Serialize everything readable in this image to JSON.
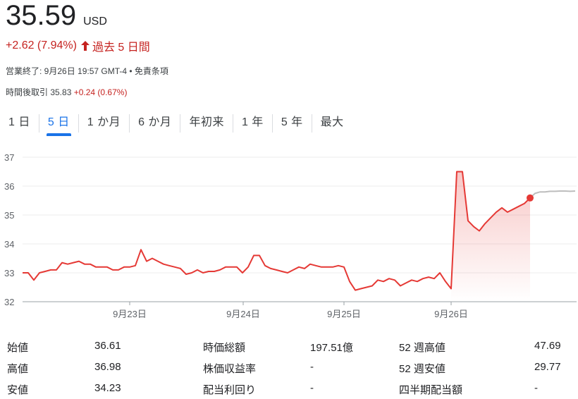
{
  "quote": {
    "price": "35.59",
    "currency": "USD",
    "change": "+2.62 (7.94%)",
    "change_period": "過去 5 日間",
    "close_status": "営業終了: 9月26日 19:57 GMT-4 • 免責条項",
    "after_hours_label": "時間後取引 35.83",
    "after_hours_change": "+0.24 (0.67%)",
    "colors": {
      "down": "#c5221f",
      "line": "#e53935",
      "accent": "#1a73e8",
      "after_hours_line": "#bdbdbd"
    }
  },
  "tabs": [
    {
      "label": "1 日",
      "active": false
    },
    {
      "label": "5 日",
      "active": true
    },
    {
      "label": "1 か月",
      "active": false
    },
    {
      "label": "6 か月",
      "active": false
    },
    {
      "label": "年初来",
      "active": false
    },
    {
      "label": "1 年",
      "active": false
    },
    {
      "label": "5 年",
      "active": false
    },
    {
      "label": "最大",
      "active": false
    }
  ],
  "chart_data": {
    "type": "area",
    "yticks": [
      32,
      33,
      34,
      35,
      36,
      37
    ],
    "ylim": [
      32,
      37
    ],
    "xlabels": [
      "9月23日",
      "9月24日",
      "9月25日",
      "9月26日"
    ],
    "grid": true,
    "series": [
      {
        "values": [
          33.0,
          33.0,
          32.75,
          33.0,
          33.05,
          33.1,
          33.1,
          33.35,
          33.3,
          33.35,
          33.4,
          33.3,
          33.3,
          33.2,
          33.2,
          33.2,
          33.1,
          33.1,
          33.2,
          33.2,
          33.25,
          33.8,
          33.4,
          33.5,
          33.4,
          33.3,
          33.25,
          33.2,
          33.15,
          32.95,
          33.0,
          33.1,
          33.0,
          33.05,
          33.05,
          33.1,
          33.2,
          33.2,
          33.2,
          33.0,
          33.2,
          33.6,
          33.6,
          33.25,
          33.15,
          33.1,
          33.05,
          33.0,
          33.1,
          33.2,
          33.15,
          33.3,
          33.25,
          33.2,
          33.2,
          33.2,
          33.25,
          33.2,
          32.7,
          32.4,
          32.45,
          32.5,
          32.55,
          32.75,
          32.7,
          32.8,
          32.75,
          32.55,
          32.65,
          32.75,
          32.7,
          32.8,
          32.85,
          32.8,
          33.0,
          32.7,
          32.45,
          36.5,
          36.5,
          34.8,
          34.6,
          34.45,
          34.7,
          34.9,
          35.1,
          35.25,
          35.1,
          35.2,
          35.3,
          35.4,
          35.59
        ]
      },
      {
        "values": [
          35.59,
          35.75,
          35.8,
          35.8,
          35.82,
          35.82,
          35.83,
          35.83,
          35.82,
          35.83
        ]
      }
    ]
  },
  "stats": {
    "col1": [
      {
        "label": "始値",
        "value": "36.61"
      },
      {
        "label": "高値",
        "value": "36.98"
      },
      {
        "label": "安値",
        "value": "34.23"
      }
    ],
    "col2": [
      {
        "label": "時価総額",
        "value": "197.51億"
      },
      {
        "label": "株価収益率",
        "value": "-"
      },
      {
        "label": "配当利回り",
        "value": "-"
      }
    ],
    "col3": [
      {
        "label": "52 週高値",
        "value": "47.69"
      },
      {
        "label": "52 週安値",
        "value": "29.77"
      },
      {
        "label": "四半期配当額",
        "value": "-"
      }
    ]
  }
}
